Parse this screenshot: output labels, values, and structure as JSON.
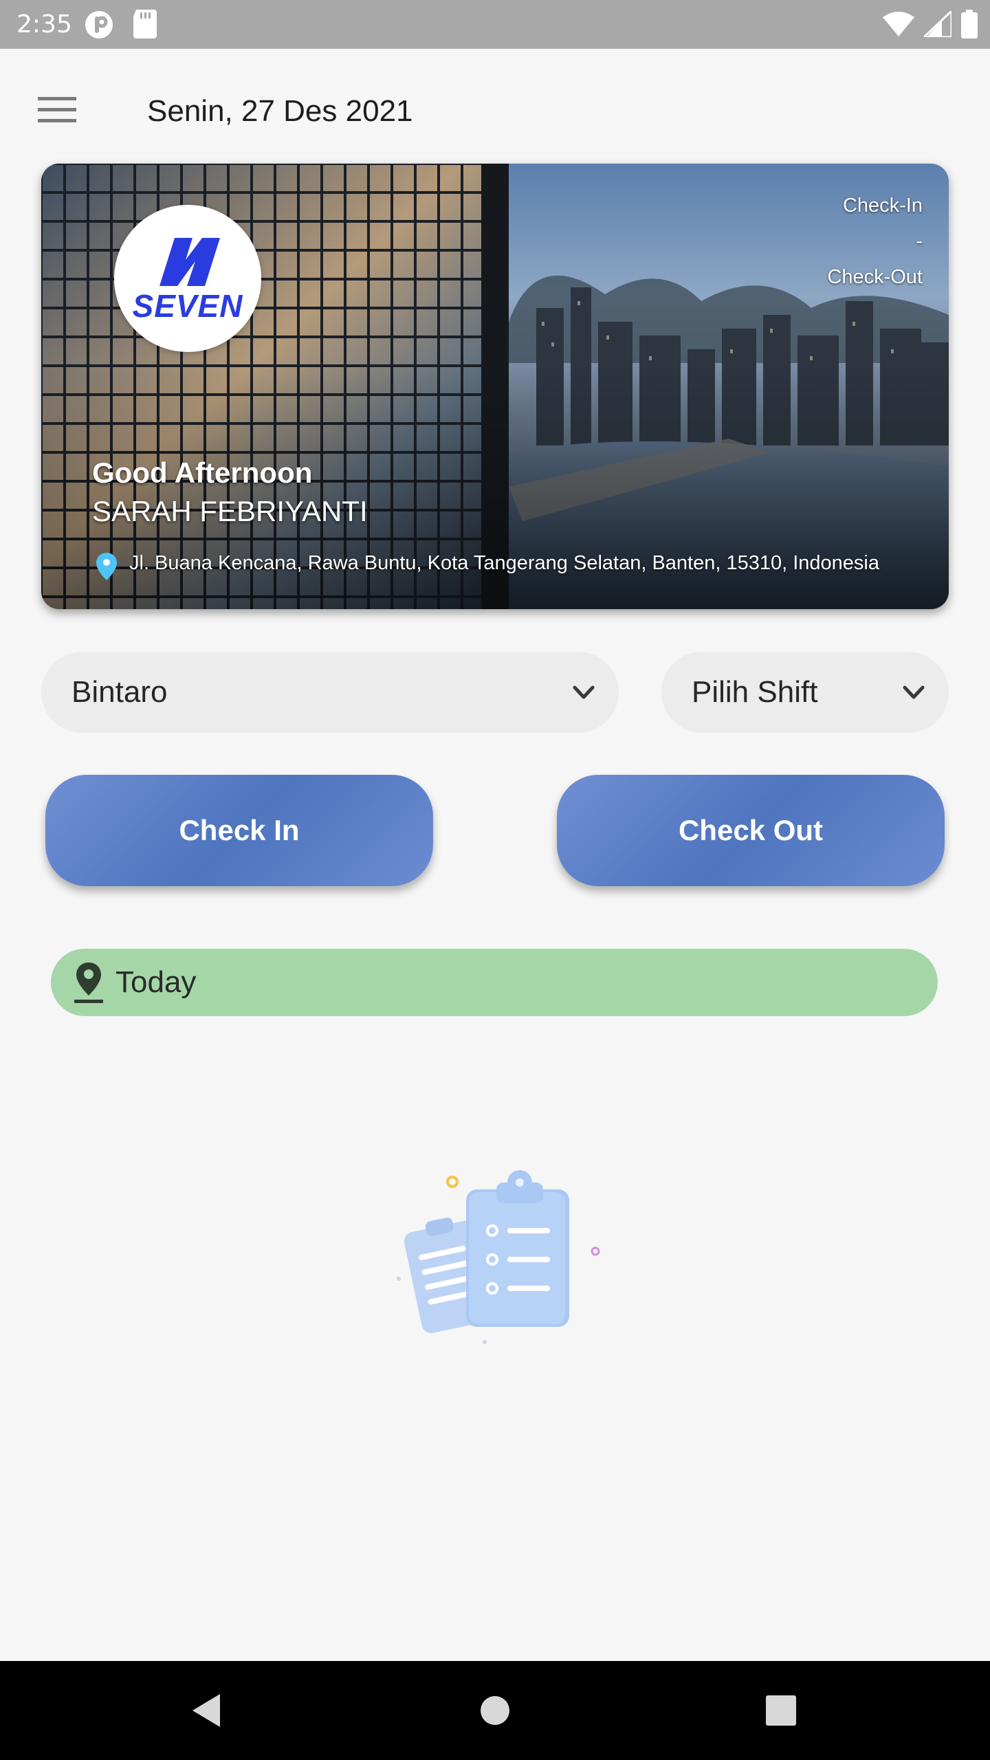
{
  "status_bar": {
    "time": "2:35",
    "left_icons": [
      "pocket-icon",
      "sd-card-icon"
    ],
    "right_icons": [
      "wifi-icon",
      "signal-icon",
      "battery-icon"
    ]
  },
  "app_bar": {
    "menu_icon": "hamburger-menu-icon",
    "date": "Senin, 27 Des 2021"
  },
  "hero": {
    "logo_text": "SEVEN",
    "check_in_label": "Check-In",
    "separator": "-",
    "check_out_label": "Check-Out",
    "greeting": "Good Afternoon",
    "name": "SARAH FEBRIYANTI",
    "address": "Jl. Buana Kencana, Rawa Buntu, Kota Tangerang Selatan, Banten, 15310, Indonesia",
    "address_icon": "location-pin-icon"
  },
  "filters": {
    "location": {
      "value": "Bintaro",
      "icon": "chevron-down-icon"
    },
    "shift": {
      "value": "Pilih Shift",
      "icon": "chevron-down-icon"
    }
  },
  "actions": {
    "check_in": "Check In",
    "check_out": "Check Out"
  },
  "today": {
    "icon": "location-pin-icon",
    "label": "Today"
  },
  "empty_state": {
    "icon": "clipboard-list-icon"
  },
  "nav_bar": {
    "back_icon": "back-triangle-icon",
    "home_icon": "home-circle-icon",
    "recents_icon": "recents-square-icon"
  },
  "colors": {
    "background": "#f6f6f6",
    "status_bar": "#a8a8a8",
    "button_blue": "#5a7ec6",
    "today_green": "#a5d6a7",
    "dropdown_bg": "#ececec",
    "logo_blue": "#2a3ce0"
  }
}
